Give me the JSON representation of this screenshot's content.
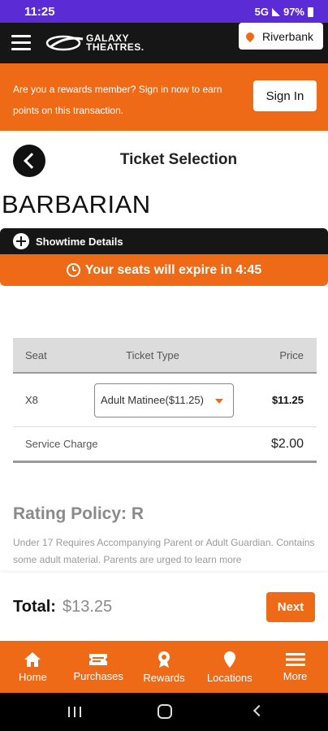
{
  "status_bar": {
    "time": "11:25",
    "network": "5G",
    "battery": "97%"
  },
  "header": {
    "logo_line1": "GALAXY",
    "logo_line2": "THEATRES.",
    "location": "Riverbank"
  },
  "rewards_banner": {
    "message": "Are you a rewards member? Sign in now to earn points on this transaction.",
    "signin_label": "Sign In"
  },
  "page": {
    "title": "Ticket Selection",
    "movie_title": "BARBARIAN"
  },
  "showtime": {
    "label": "Showtime Details"
  },
  "expiry": {
    "message": "Your seats will expire in 4:45"
  },
  "table": {
    "headers": {
      "seat": "Seat",
      "type": "Ticket Type",
      "price": "Price"
    },
    "rows": [
      {
        "seat": "X8",
        "ticket_type": "Adult Matinee($11.25)",
        "price": "$11.25"
      }
    ],
    "service_charge": {
      "label": "Service Charge",
      "value": "$2.00"
    }
  },
  "rating": {
    "title": "Rating Policy: R",
    "text": "Under 17 Requires Accompanying Parent or Adult Guardian. Contains some adult material. Parents are urged to learn more"
  },
  "total": {
    "label": "Total:",
    "value": "$13.25",
    "next_label": "Next"
  },
  "bottom_nav": [
    {
      "label": "Home",
      "icon": "home-icon"
    },
    {
      "label": "Purchases",
      "icon": "ticket-icon"
    },
    {
      "label": "Rewards",
      "icon": "award-icon"
    },
    {
      "label": "Locations",
      "icon": "location-pin-icon"
    },
    {
      "label": "More",
      "icon": "menu-icon"
    }
  ],
  "colors": {
    "accent": "#ee6a17",
    "dark": "#161616",
    "statusbar": "#5b2bd6"
  }
}
